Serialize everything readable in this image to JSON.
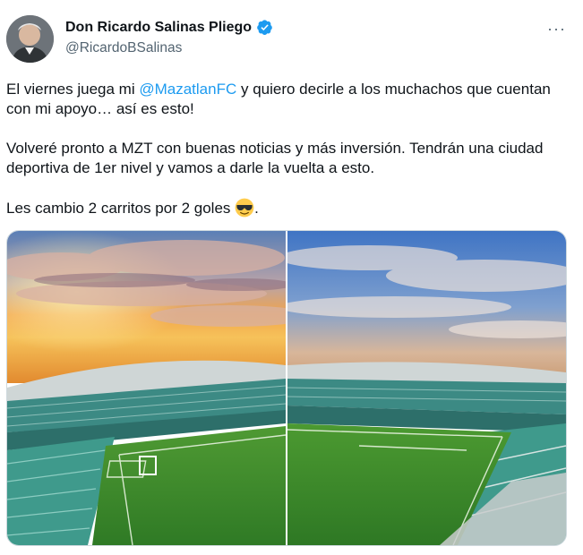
{
  "author": {
    "name": "Don Ricardo Salinas Pliego",
    "handle": "@RicardoBSalinas",
    "avatar_icon": "profile-avatar",
    "verified_icon": "verified-badge-icon",
    "verified_color": "#1d9bf0"
  },
  "menu": {
    "more_label": "···"
  },
  "tweet": {
    "p1_pre": "El viernes juega mi ",
    "p1_mention": "@MazatlanFC",
    "p1_post": " y quiero decirle a los muchachos que cuentan con mi apoyo… así es esto!",
    "p2": "Volveré pronto a MZT con buenas noticias y más inversión. Tendrán una ciudad deportiva de 1er nivel y vamos a darle la vuelta a esto.",
    "p3_pre": "Les cambio 2 carritos por 2 goles ",
    "p3_emoji": "smiling-face-with-sunglasses-icon",
    "p3_post": "."
  },
  "media": {
    "photos": [
      {
        "name": "stadium-photo-sunset"
      },
      {
        "name": "stadium-photo-day"
      }
    ]
  },
  "colors": {
    "mention": "#1d9bf0",
    "secondary_text": "#536471",
    "pitch_green": "#3f8a2a",
    "seat_teal": "#3d8f86"
  }
}
